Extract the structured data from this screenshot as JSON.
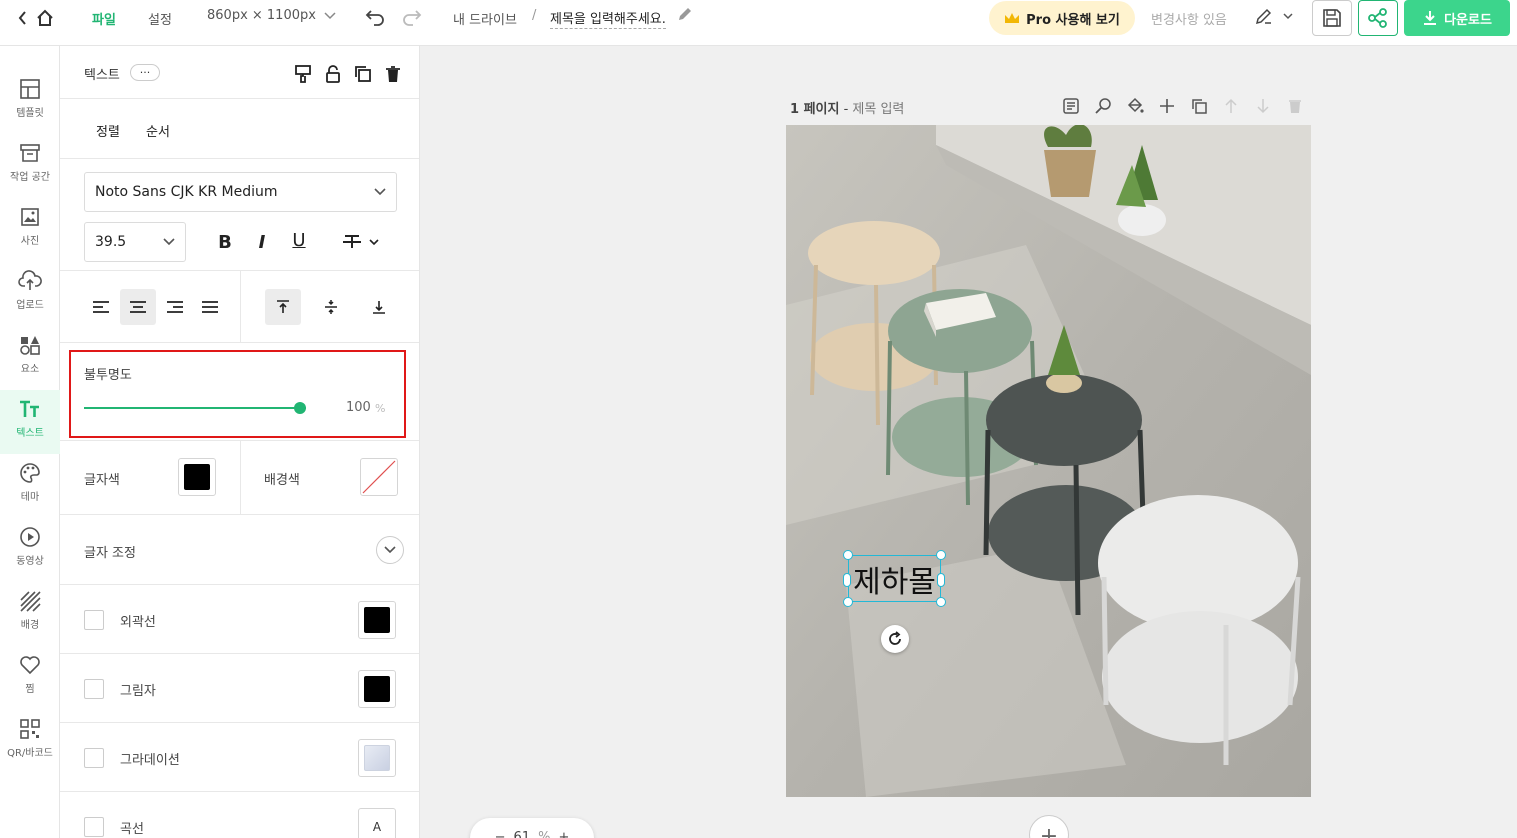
{
  "topbar": {
    "file_label": "파일",
    "settings_label": "설정",
    "size_label": "860px × 1100px",
    "drive_label": "내 드라이브",
    "breadcrumb_sep": "/",
    "doc_title": "제목을 입력해주세요.",
    "pro_label": "Pro 사용해 보기",
    "changes_label": "변경사항 있음",
    "download_label": "다운로드"
  },
  "nav": {
    "items": [
      {
        "label": "템플릿",
        "icon": "template-icon"
      },
      {
        "label": "작업 공간",
        "icon": "archive-icon"
      },
      {
        "label": "사진",
        "icon": "image-icon"
      },
      {
        "label": "업로드",
        "icon": "upload-icon"
      },
      {
        "label": "요소",
        "icon": "shapes-icon"
      },
      {
        "label": "텍스트",
        "icon": "text-icon"
      },
      {
        "label": "테마",
        "icon": "palette-icon"
      },
      {
        "label": "동영상",
        "icon": "play-icon"
      },
      {
        "label": "배경",
        "icon": "background-icon"
      },
      {
        "label": "찜",
        "icon": "heart-icon"
      },
      {
        "label": "QR/바코드",
        "icon": "qr-icon"
      }
    ]
  },
  "panel": {
    "header_title": "텍스트",
    "more_label": "···",
    "tab_align": "정렬",
    "tab_order": "순서",
    "font_family": "Noto Sans CJK KR Medium",
    "font_size": "39.5",
    "bold_label": "B",
    "italic_label": "I",
    "underline_label": "U",
    "opacity_label": "불투명도",
    "opacity_value": 100,
    "opacity_value_text": "100",
    "opacity_unit": "%",
    "text_color_label": "글자색",
    "bg_color_label": "배경색",
    "text_adjust_label": "글자 조정",
    "outline_label": "외곽선",
    "shadow_label": "그림자",
    "gradient_label": "그라데이션",
    "curve_label": "곡선",
    "curve_icon_letter": "A"
  },
  "canvas": {
    "page_number": "1 페이지",
    "page_sep": " - ",
    "page_title": "제목 입력",
    "selected_text": "제하몰",
    "zoom_value": "61",
    "zoom_unit": "%"
  },
  "colors": {
    "accent": "#21b573",
    "selection": "#23b8d6",
    "highlight_border": "#e01818",
    "text_color": "#000000"
  }
}
